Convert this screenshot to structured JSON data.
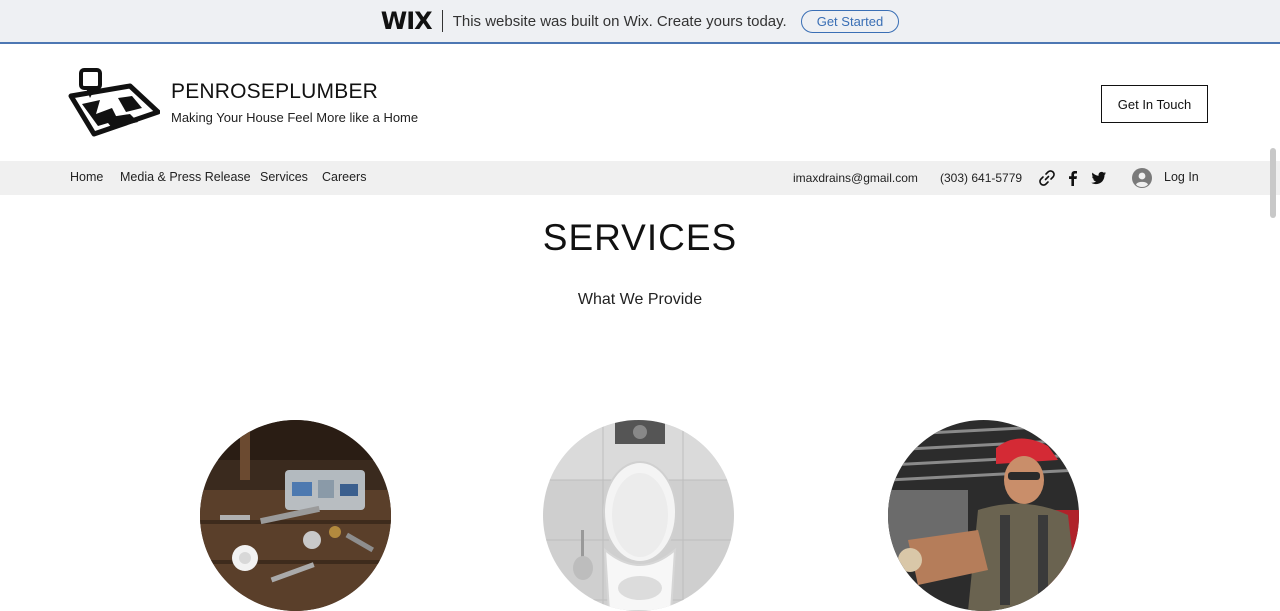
{
  "wix_banner": {
    "logo": "WIX",
    "message": "This website was built on Wix. Create yours today.",
    "cta": "Get Started"
  },
  "header": {
    "title": "PENROSEPLUMBER",
    "tagline": "Making Your House Feel More like a Home",
    "cta": "Get In Touch"
  },
  "nav": {
    "items": [
      "Home",
      "Media & Press Release",
      "Services",
      "Careers"
    ],
    "email": "imaxdrains@gmail.com",
    "phone": "(303) 641-5779",
    "social_icons": [
      "link-icon",
      "facebook-icon",
      "twitter-icon"
    ],
    "login": "Log In"
  },
  "main": {
    "title": "SERVICES",
    "subtitle": "What We Provide",
    "images": [
      "tools-workbench-photo",
      "toilet-photo",
      "plumber-worker-photo"
    ]
  },
  "colors": {
    "banner_bg": "#eef0f3",
    "banner_accent": "#3a6fb5",
    "nav_bg": "#f0f0f0",
    "text": "#111111"
  }
}
